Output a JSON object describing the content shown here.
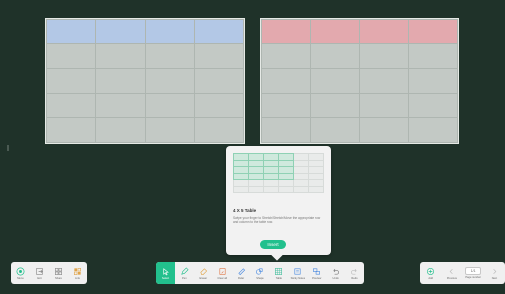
{
  "board": {
    "tables": [
      {
        "name": "left",
        "rows": 5,
        "cols": 4,
        "header_color": "#b3c8e6"
      },
      {
        "name": "right",
        "rows": 5,
        "cols": 4,
        "header_color": "#e3a9ae"
      }
    ]
  },
  "popup": {
    "title": "4 X 5 Table",
    "description": "Swipe your finger to Stretch/Stretch/Move the appropriate row and column to the table row.",
    "insert_label": "Insert",
    "preview_rows": 6,
    "preview_cols": 6,
    "selected_rows": 4,
    "selected_cols": 4
  },
  "toolbar_left": [
    {
      "name": "menu",
      "label": "Menu",
      "icon": "menu-icon"
    },
    {
      "name": "exit",
      "label": "Exit",
      "icon": "exit-icon"
    },
    {
      "name": "share",
      "label": "Share",
      "icon": "share-icon"
    },
    {
      "name": "link",
      "label": "Link",
      "icon": "link-icon"
    }
  ],
  "toolbar_center": [
    {
      "name": "select",
      "label": "Select",
      "icon": "select-icon",
      "active": true
    },
    {
      "name": "pen",
      "label": "Pen",
      "icon": "pen-icon"
    },
    {
      "name": "eraser",
      "label": "Eraser",
      "icon": "eraser-icon"
    },
    {
      "name": "clear-all",
      "label": "Clear all",
      "icon": "clear-icon"
    },
    {
      "name": "ruler",
      "label": "Ruler",
      "icon": "ruler-icon"
    },
    {
      "name": "shape",
      "label": "Shape",
      "icon": "shape-icon"
    },
    {
      "name": "table",
      "label": "Table",
      "icon": "table-icon"
    },
    {
      "name": "sticky-notes",
      "label": "Sticky Notes",
      "icon": "sticky-notes-icon"
    },
    {
      "name": "preview",
      "label": "Preview",
      "icon": "preview-icon"
    },
    {
      "name": "undo",
      "label": "Undo",
      "icon": "undo-icon"
    },
    {
      "name": "redo",
      "label": "Redo",
      "icon": "redo-icon"
    }
  ],
  "toolbar_right": {
    "add_label": "Add",
    "previous_label": "Previous",
    "page_number_label": "Page number",
    "next_label": "Next",
    "page_indicator": "1/1"
  },
  "colors": {
    "background": "#1f3229",
    "accent": "#22c08d"
  }
}
